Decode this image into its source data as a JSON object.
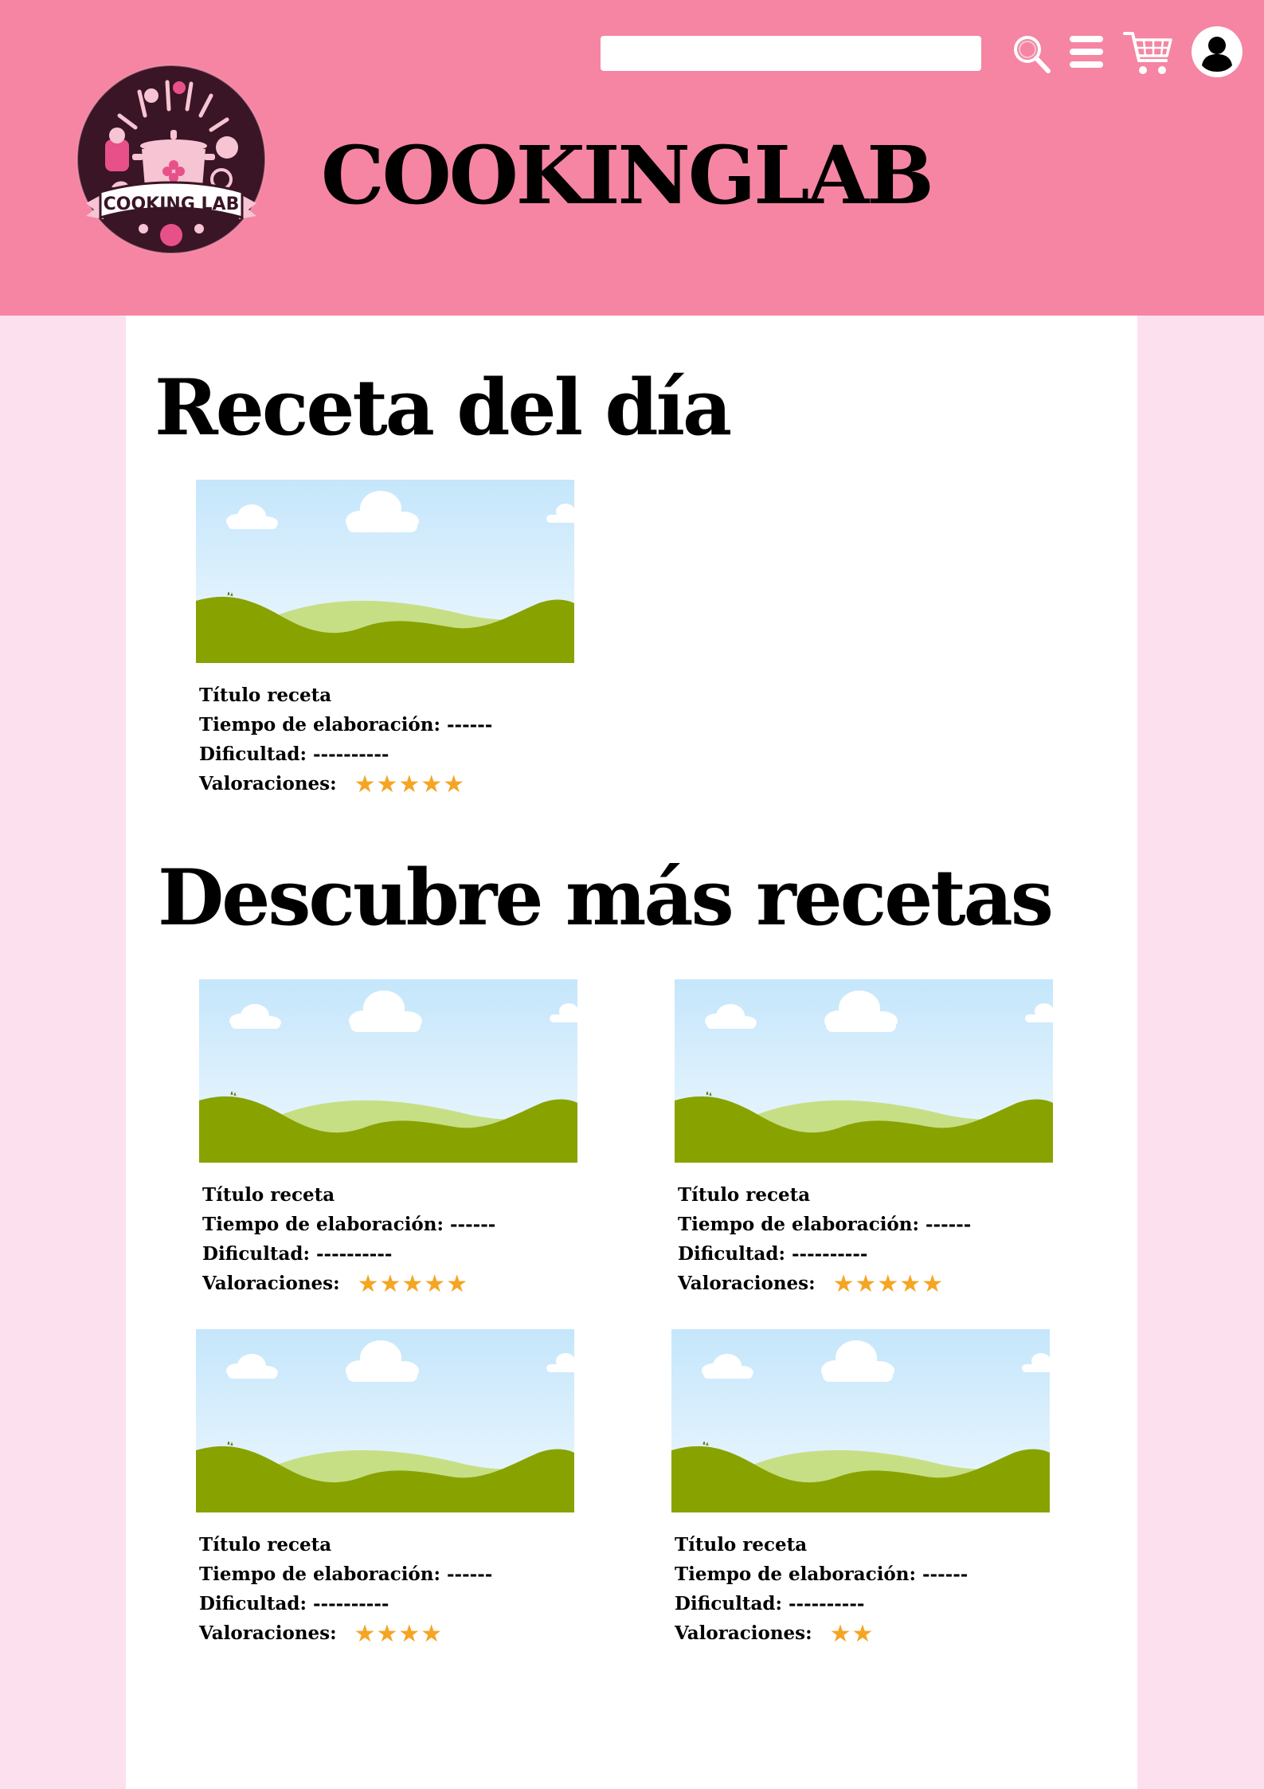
{
  "header": {
    "brand": "COOKINGLAB",
    "logo_text": "COOKING LAB",
    "search": {
      "placeholder": "",
      "value": ""
    },
    "icons": [
      "search-icon",
      "menu-icon",
      "cart-icon",
      "user-icon"
    ],
    "bg_color": "#f585a2"
  },
  "featured": {
    "heading": "Receta del día",
    "recipe": {
      "title": "Título receta",
      "time_label": "Tiempo de elaboración:",
      "time_value": "------",
      "difficulty_label": "Dificultad:",
      "difficulty_value": "----------",
      "rating_label": "Valoraciones:",
      "rating": 5,
      "rating_stars": "★★★★★"
    }
  },
  "discover": {
    "heading": "Descubre más recetas",
    "recipes": [
      {
        "title": "Título receta",
        "time_label": "Tiempo de elaboración:",
        "time_value": "------",
        "difficulty_label": "Dificultad:",
        "difficulty_value": "----------",
        "rating_label": "Valoraciones:",
        "rating": 5,
        "rating_stars": "★★★★★"
      },
      {
        "title": "Título receta",
        "time_label": "Tiempo de elaboración:",
        "time_value": "------",
        "difficulty_label": "Dificultad:",
        "difficulty_value": "----------",
        "rating_label": "Valoraciones:",
        "rating": 5,
        "rating_stars": "★★★★★"
      },
      {
        "title": "Título receta",
        "time_label": "Tiempo de elaboración:",
        "time_value": "------",
        "difficulty_label": "Dificultad:",
        "difficulty_value": "----------",
        "rating_label": "Valoraciones:",
        "rating": 4,
        "rating_stars": "★★★★"
      },
      {
        "title": "Título receta",
        "time_label": "Tiempo de elaboración:",
        "time_value": "------",
        "difficulty_label": "Dificultad:",
        "difficulty_value": "----------",
        "rating_label": "Valoraciones:",
        "rating": 2,
        "rating_stars": "★★"
      }
    ]
  },
  "colors": {
    "header_bg": "#f585a2",
    "page_bg": "#fde0ee",
    "content_bg": "#ffffff",
    "star": "#f5a524",
    "logo_dark": "#3a1526",
    "logo_pink": "#e8508a"
  }
}
